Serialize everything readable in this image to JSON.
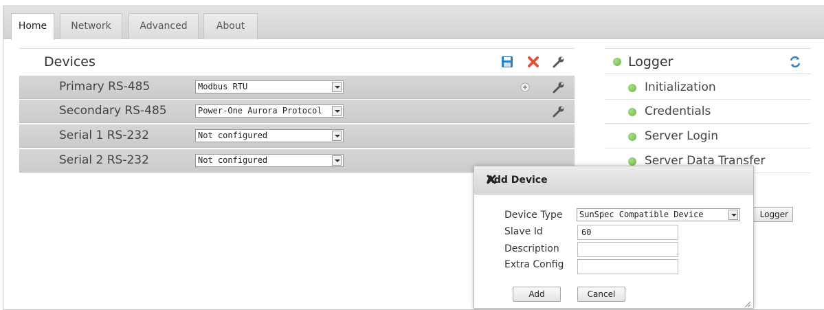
{
  "tabs": [
    {
      "label": "Home"
    },
    {
      "label": "Network"
    },
    {
      "label": "Advanced"
    },
    {
      "label": "About"
    }
  ],
  "devices": {
    "title": "Devices",
    "rows": [
      {
        "label": "Primary RS-485",
        "selected": "Modbus RTU"
      },
      {
        "label": "Secondary RS-485",
        "selected": "Power-One Aurora Protocol"
      },
      {
        "label": "Serial 1 RS-232",
        "selected": "Not configured"
      },
      {
        "label": "Serial 2 RS-232",
        "selected": "Not configured"
      }
    ],
    "icons": {
      "save": "save-icon",
      "delete": "close-icon",
      "configure": "wrench-icon",
      "add": "plus-circle-icon"
    }
  },
  "logger": {
    "title": "Logger",
    "items": [
      {
        "label": "Initialization",
        "status": "ok"
      },
      {
        "label": "Credentials",
        "status": "ok"
      },
      {
        "label": "Server Login",
        "status": "ok"
      },
      {
        "label": "Server Data Transfer",
        "status": "ok"
      }
    ],
    "button_label": "Logger",
    "status_color": "#6fb84a"
  },
  "dialog": {
    "title": "Add Device",
    "fields": [
      {
        "label": "Device Type",
        "value": "SunSpec Compatible Device"
      },
      {
        "label": "Slave Id",
        "value": "60"
      },
      {
        "label": "Description",
        "value": ""
      },
      {
        "label": "Extra Config",
        "value": ""
      }
    ],
    "add_label": "Add",
    "cancel_label": "Cancel"
  },
  "colors": {
    "accent_blue": "#2f7fc1",
    "delete_red": "#e0533a",
    "status_green": "#6fb84a"
  }
}
